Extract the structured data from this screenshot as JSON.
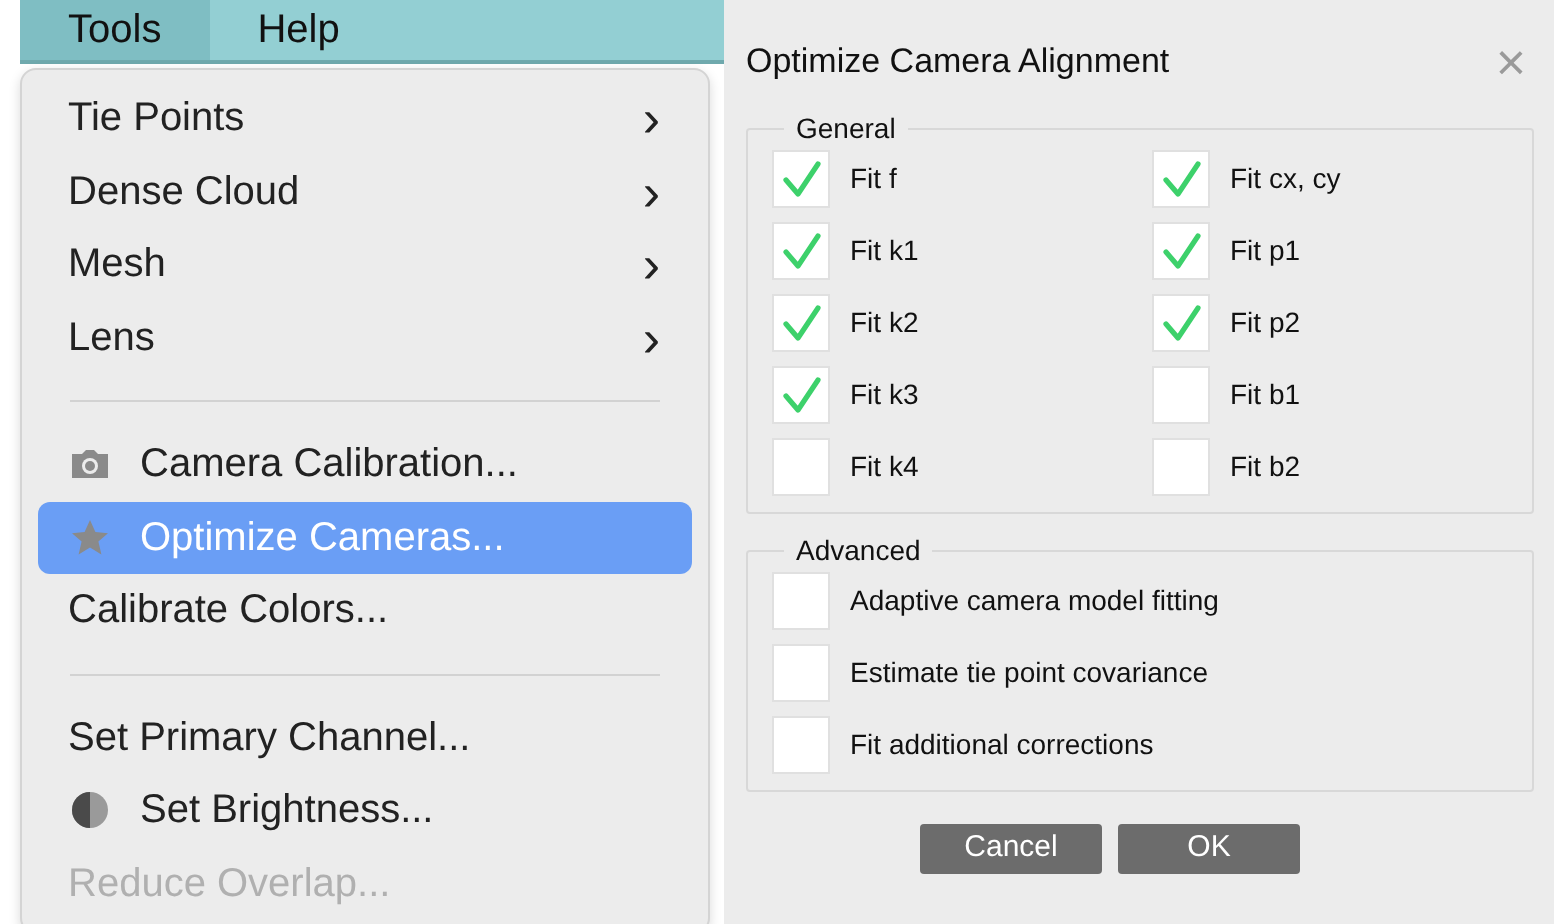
{
  "menubar": [
    {
      "label": "Tools",
      "selected": true
    },
    {
      "label": "Help",
      "selected": false
    }
  ],
  "menu": [
    {
      "kind": "submenu",
      "label": "Tie Points",
      "selected": false,
      "disabled": false,
      "arrow": "›"
    },
    {
      "kind": "submenu",
      "label": "Dense Cloud",
      "selected": false,
      "disabled": false,
      "arrow": "›"
    },
    {
      "kind": "submenu",
      "label": "Mesh",
      "selected": false,
      "disabled": false,
      "arrow": "›"
    },
    {
      "kind": "submenu",
      "label": "Lens",
      "selected": false,
      "disabled": false,
      "arrow": "›"
    },
    {
      "kind": "separator"
    },
    {
      "kind": "camera",
      "label": "Camera Calibration...",
      "selected": false,
      "disabled": false
    },
    {
      "kind": "star",
      "label": "Optimize Cameras...",
      "selected": true,
      "disabled": false
    },
    {
      "kind": "plain",
      "label": "Calibrate Colors...",
      "selected": false,
      "disabled": false
    },
    {
      "kind": "separator"
    },
    {
      "kind": "plain",
      "label": "Set Primary Channel...",
      "selected": false,
      "disabled": false
    },
    {
      "kind": "brightness",
      "label": "Set Brightness...",
      "selected": false,
      "disabled": false
    },
    {
      "kind": "plain",
      "label": "Reduce Overlap...",
      "selected": false,
      "disabled": true
    }
  ],
  "dialog": {
    "title": "Optimize Camera Alignment",
    "close": "×",
    "general": {
      "title": "General",
      "options": [
        {
          "label": "Fit f",
          "checked": true
        },
        {
          "label": "Fit cx, cy",
          "checked": true
        },
        {
          "label": "Fit k1",
          "checked": true
        },
        {
          "label": "Fit p1",
          "checked": true
        },
        {
          "label": "Fit k2",
          "checked": true
        },
        {
          "label": "Fit p2",
          "checked": true
        },
        {
          "label": "Fit k3",
          "checked": true
        },
        {
          "label": "Fit b1",
          "checked": false
        },
        {
          "label": "Fit k4",
          "checked": false
        },
        {
          "label": "Fit b2",
          "checked": false
        }
      ]
    },
    "advanced": {
      "title": "Advanced",
      "options": [
        {
          "label": "Adaptive camera model fitting",
          "checked": false
        },
        {
          "label": "Estimate tie point covariance",
          "checked": false
        },
        {
          "label": "Fit additional corrections",
          "checked": false
        }
      ]
    },
    "buttons": [
      "Cancel",
      "OK"
    ]
  }
}
